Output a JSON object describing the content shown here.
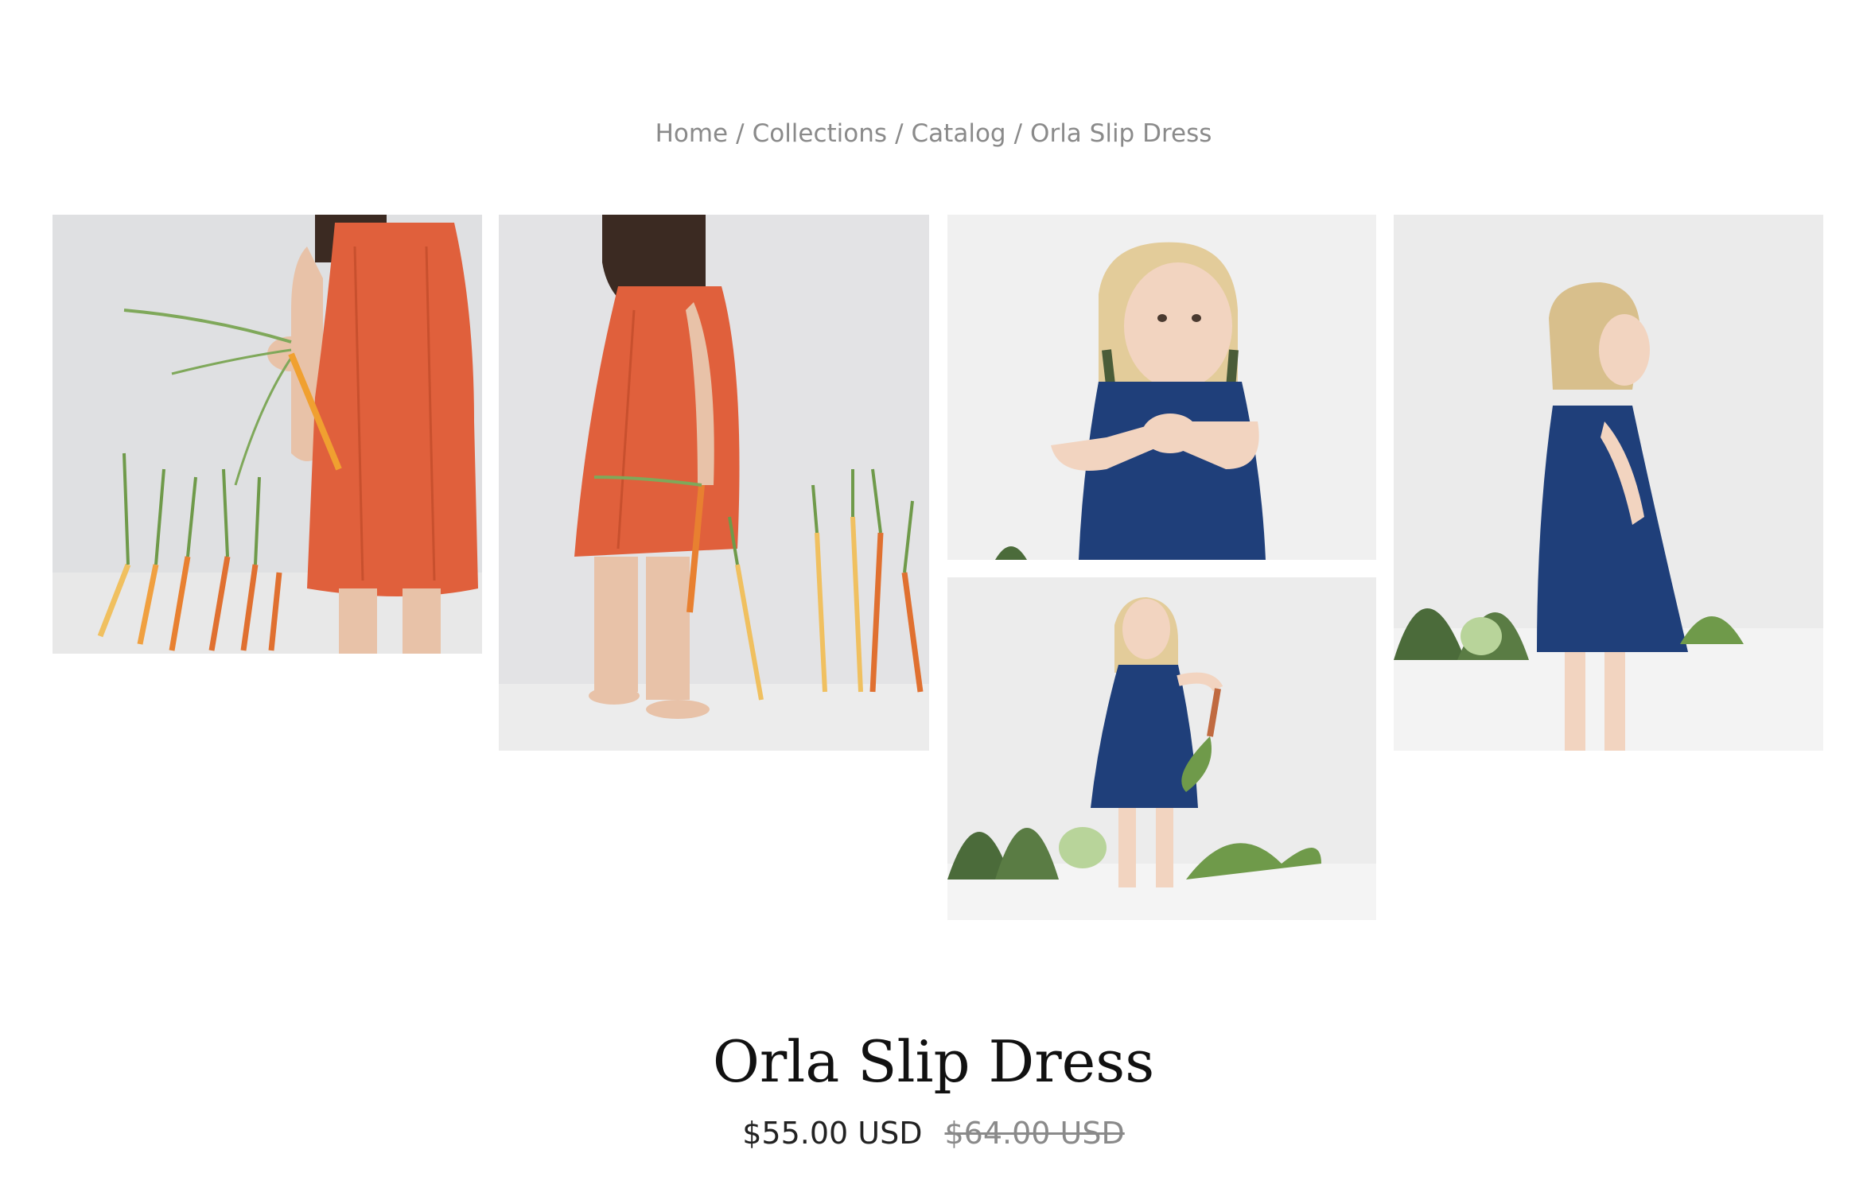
{
  "breadcrumb": {
    "items": [
      {
        "label": "Home"
      },
      {
        "label": "Collections"
      },
      {
        "label": "Catalog"
      },
      {
        "label": "Orla Slip Dress"
      }
    ],
    "separator": "/"
  },
  "gallery": {
    "photos": [
      {
        "subject": "child in orange slip dress holding carrots, carrots leaning on wall",
        "dress_color": "#e2603c"
      },
      {
        "subject": "child in orange slip dress side view, barefoot, carrots along wall",
        "dress_color": "#e2603c"
      },
      {
        "subject": "blonde child in navy slip dress with hands together",
        "dress_color": "#1f3f7a"
      },
      {
        "subject": "blonde child in navy slip dress holding beet, vegetables on floor",
        "dress_color": "#1f3f7a"
      },
      {
        "subject": "blonde child in navy slip dress side view, greens on floor",
        "dress_color": "#1f3f7a"
      }
    ]
  },
  "product": {
    "title": "Orla Slip Dress",
    "price": "$55.00 USD",
    "compare_at_price": "$64.00 USD"
  },
  "colors": {
    "breadcrumb": "#8a8a8a",
    "title": "#111111",
    "price": "#222222",
    "compare_price": "#8a8a8a"
  }
}
